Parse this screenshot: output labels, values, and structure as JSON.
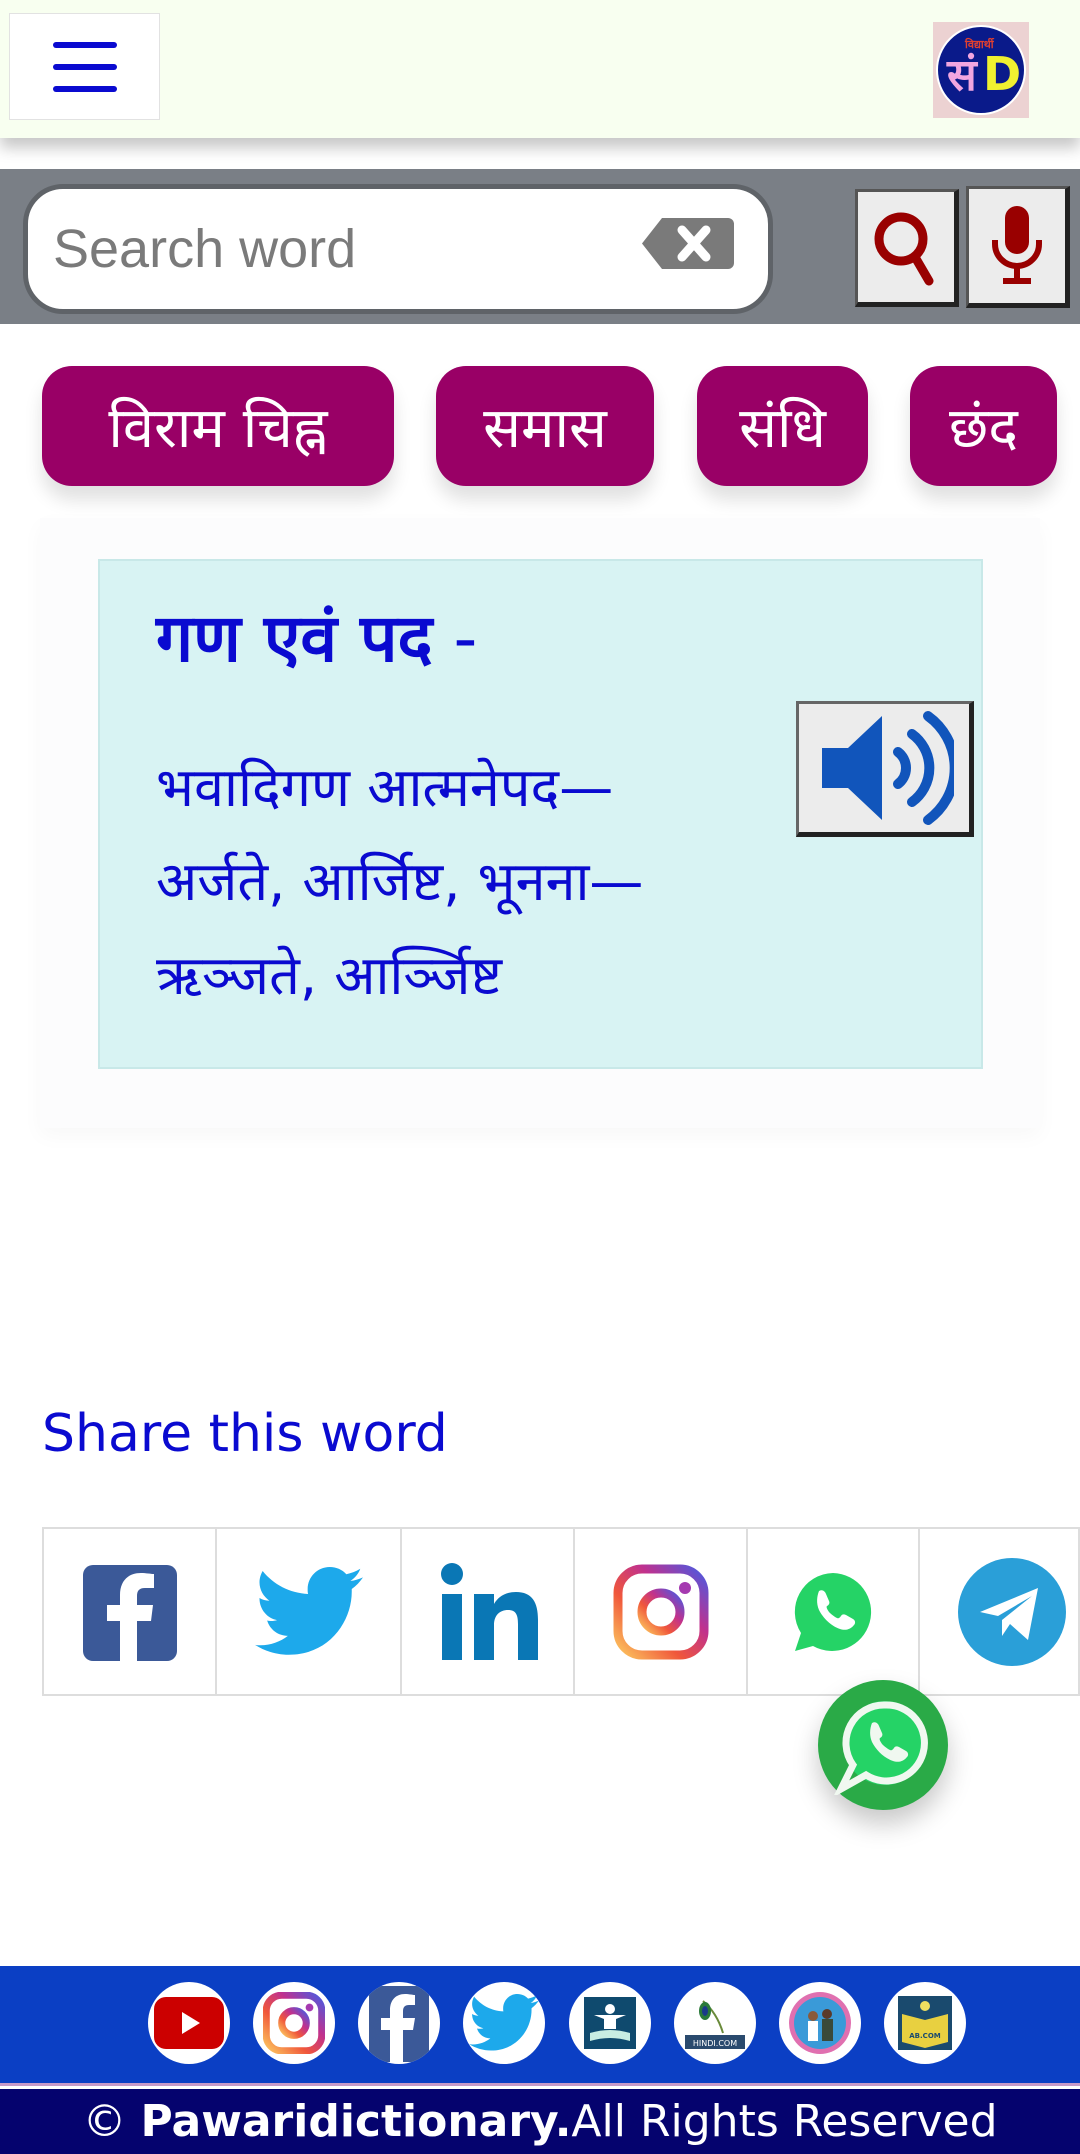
{
  "header": {
    "menu_icon": "hamburger-menu-icon",
    "logo_text": "सं",
    "logo_letter": "D",
    "logo_small_text": "विद्यार्थी"
  },
  "search": {
    "placeholder": "Search word",
    "value": "",
    "clear_icon": "backspace-clear-icon",
    "search_icon": "search-icon",
    "mic_icon": "microphone-icon"
  },
  "categories": [
    {
      "label": "विराम चिह्न"
    },
    {
      "label": "समास"
    },
    {
      "label": "संधि"
    },
    {
      "label": "छंद"
    }
  ],
  "word": {
    "title": "गण एवं पद",
    "title_suffix": " -",
    "definition": "भवादिगण आत्मनेपद— अर्जते, आर्जिष्ट, भूनना— ऋञ्जते, आर्ञ्जिष्ट",
    "audio_icon": "speaker-volume-icon"
  },
  "share": {
    "title": "Share this word",
    "items": [
      {
        "name": "facebook",
        "icon": "facebook-icon",
        "color": "#3b5998"
      },
      {
        "name": "twitter",
        "icon": "twitter-icon",
        "color": "#1da1f2"
      },
      {
        "name": "linkedin",
        "icon": "linkedin-icon",
        "color": "#0a77b5"
      },
      {
        "name": "instagram",
        "icon": "instagram-icon",
        "color": "#c13584"
      },
      {
        "name": "whatsapp",
        "icon": "whatsapp-icon",
        "color": "#25d366"
      },
      {
        "name": "telegram",
        "icon": "telegram-icon",
        "color": "#2a9fd8"
      }
    ]
  },
  "floating_whatsapp": {
    "icon": "whatsapp-icon",
    "color": "#2aaa47"
  },
  "footer": {
    "social": [
      {
        "name": "youtube",
        "icon": "youtube-icon"
      },
      {
        "name": "instagram",
        "icon": "instagram-icon"
      },
      {
        "name": "facebook",
        "icon": "facebook-icon"
      },
      {
        "name": "twitter",
        "icon": "twitter-icon"
      },
      {
        "name": "site-1",
        "icon": "book-person-logo-icon"
      },
      {
        "name": "hindi-com",
        "icon": "peacock-feather-logo-icon",
        "label": "HINDI.COM"
      },
      {
        "name": "site-3",
        "icon": "kids-photo-logo-icon"
      },
      {
        "name": "ab-com",
        "icon": "open-book-logo-icon",
        "label": "AB.COM"
      }
    ],
    "copyright_symbol": "©",
    "brand": "Pawaridictionary.",
    "rights": " All Rights Reserved"
  },
  "colors": {
    "accent_blue": "#0a0ad0",
    "category_bg": "#990066",
    "card_bg": "#d8f3f3",
    "icon_red": "#990000",
    "footer_blue": "#0b3fc4",
    "footer_dark": "#05036e"
  }
}
